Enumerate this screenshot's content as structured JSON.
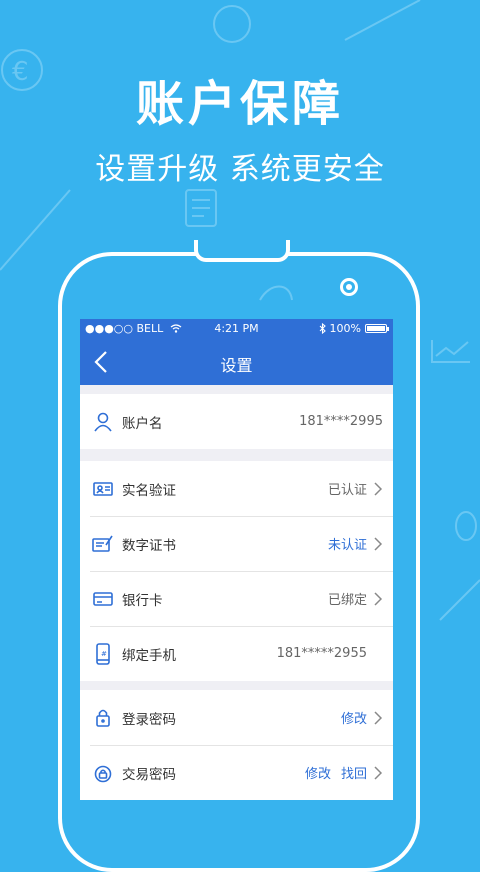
{
  "promo": {
    "title": "账户保障",
    "subtitle": "设置升级 系统更安全"
  },
  "status_bar": {
    "carrier": "●●●○○ BELL",
    "time": "4:21 PM",
    "battery": "100%"
  },
  "nav": {
    "title": "设置"
  },
  "account": {
    "label": "账户名",
    "value": "181****2995"
  },
  "verification": [
    {
      "label": "实名验证",
      "value": "已认证",
      "value_style": "gray"
    },
    {
      "label": "数字证书",
      "value": "未认证",
      "value_style": "blue"
    },
    {
      "label": "银行卡",
      "value": "已绑定",
      "value_style": "gray"
    },
    {
      "label": "绑定手机",
      "value": "181*****2955",
      "value_style": "gray"
    }
  ],
  "security": [
    {
      "label": "登录密码",
      "action1": "修改"
    },
    {
      "label": "交易密码",
      "action1": "修改",
      "action2": "找回"
    }
  ],
  "colors": {
    "background": "#37b3ee",
    "header": "#2f6fd6",
    "accent": "#2f6fd6"
  },
  "icons": [
    "user-icon",
    "id-card-icon",
    "certificate-icon",
    "bank-card-icon",
    "phone-icon",
    "lock-icon",
    "trade-lock-icon",
    "bluetooth-icon",
    "wifi-icon",
    "back-icon",
    "chevron-right-icon"
  ]
}
